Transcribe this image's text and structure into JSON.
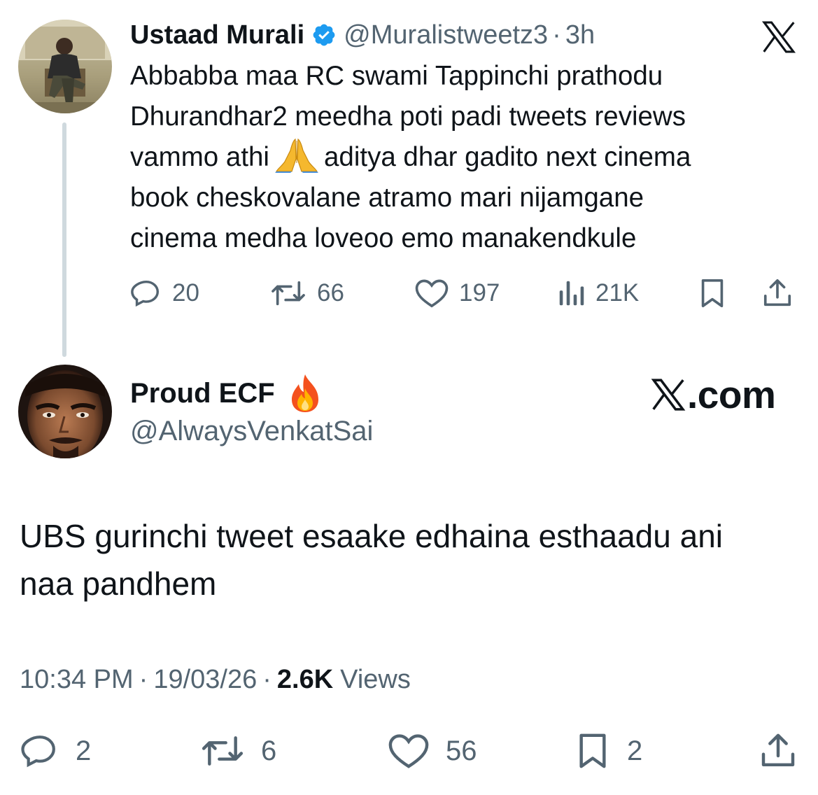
{
  "tweet1": {
    "display_name": "Ustaad Murali",
    "handle": "@Muralistweetz3",
    "separator": "·",
    "time": "3h",
    "verified_icon": "verified-badge-icon",
    "text_lines": [
      "Abbabba maa RC swami Tappinchi prathodu",
      "Dhurandhar2 meedha poti padi tweets reviews",
      "vammo athi",
      "aditya dhar gadito next cinema",
      "book cheskovalane atramo mari nijamgane",
      "cinema medha loveoo emo manakendkule"
    ],
    "emoji": "folded-hands-emoji",
    "replies": "20",
    "reposts": "66",
    "likes": "197",
    "views": "21K"
  },
  "tweet2": {
    "display_name": "Proud ECF",
    "emoji": "fire-emoji",
    "handle": "@AlwaysVenkatSai",
    "brand_text": ".com",
    "text_lines": [
      "UBS gurinchi tweet esaake edhaina esthaadu ani",
      "naa pandhem"
    ],
    "time": "10:34 PM",
    "date": "19/03/26",
    "separator": "·",
    "views_count": "2.6K",
    "views_label": "Views",
    "replies": "2",
    "reposts": "6",
    "likes": "56",
    "bookmarks": "2"
  },
  "colors": {
    "text_primary": "#0f1419",
    "text_secondary": "#536471",
    "verified_blue": "#1d9bf0",
    "thread_line": "#cfd9de"
  }
}
